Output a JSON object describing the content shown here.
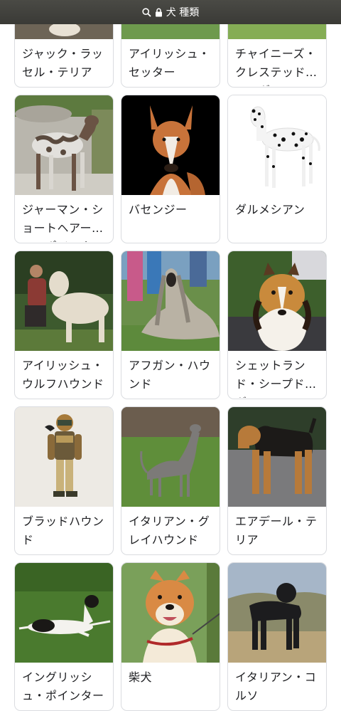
{
  "address_bar": {
    "title": "犬 種類"
  },
  "cards": [
    {
      "label": "ジャック・ラッセル・テリア"
    },
    {
      "label": "アイリッシュ・セッター"
    },
    {
      "label": "チャイニーズ・クレステッド・ドッグ"
    },
    {
      "label": "ジャーマン・ショートヘアード・ポインター"
    },
    {
      "label": "バセンジー"
    },
    {
      "label": "ダルメシアン"
    },
    {
      "label": "アイリッシュ・ウルフハウンド"
    },
    {
      "label": "アフガン・ハウンド"
    },
    {
      "label": "シェットランド・シープドッグ"
    },
    {
      "label": "ブラッドハウンド"
    },
    {
      "label": "イタリアン・グレイハウンド"
    },
    {
      "label": "エアデール・テリア"
    },
    {
      "label": "イングリッシュ・ポインター"
    },
    {
      "label": "柴犬"
    },
    {
      "label": "イタリアン・コルソ"
    }
  ]
}
